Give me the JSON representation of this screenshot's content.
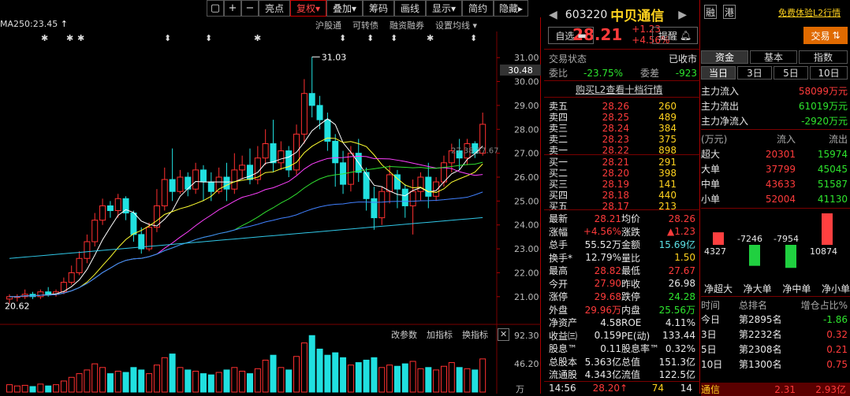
{
  "toolbar": {
    "items": [
      "亮点",
      "复权",
      "叠加",
      "筹码",
      "画线",
      "显示",
      "简约",
      "隐藏"
    ],
    "active": "复权",
    "icons": [
      "box-icon",
      "plus-icon",
      "minus-icon"
    ]
  },
  "chart": {
    "ma_label": "MA250:23.45",
    "sub_links": [
      "沪股通",
      "可转债",
      "融资融券",
      "设置均线"
    ],
    "y_ticks": [
      "31.00",
      "30.00",
      "29.00",
      "28.00",
      "27.00",
      "26.00",
      "25.00",
      "24.00",
      "23.00",
      "22.00",
      "21.00"
    ],
    "current_price_tag": "30.48",
    "high_label": "31.03",
    "low_label": "20.62",
    "mid_label": "27.38,27.67",
    "sub_links2": [
      "改参数",
      "加指标",
      "换指标"
    ],
    "vol_ticks": [
      "92.30",
      "46.20"
    ],
    "vol_unit": "万"
  },
  "chart_data": {
    "type": "candlestick",
    "y_range": [
      20.5,
      31.5
    ],
    "candles": [
      [
        20.9,
        21.0,
        20.7,
        21.1
      ],
      [
        21.0,
        21.0,
        20.8,
        21.1
      ],
      [
        21.0,
        21.1,
        20.9,
        21.3
      ],
      [
        21.1,
        21.0,
        20.9,
        21.2
      ],
      [
        21.0,
        21.2,
        20.9,
        21.3
      ],
      [
        21.2,
        21.1,
        21.0,
        21.4
      ],
      [
        21.1,
        21.2,
        21.0,
        21.3
      ],
      [
        21.2,
        21.6,
        21.1,
        21.8
      ],
      [
        21.6,
        22.0,
        21.5,
        22.3
      ],
      [
        22.0,
        22.6,
        21.9,
        22.9
      ],
      [
        22.6,
        23.3,
        22.4,
        23.6
      ],
      [
        23.3,
        24.2,
        23.1,
        24.5
      ],
      [
        24.2,
        24.8,
        24.0,
        25.1
      ],
      [
        24.8,
        24.6,
        24.3,
        25.0
      ],
      [
        24.6,
        25.1,
        24.3,
        25.3
      ],
      [
        25.1,
        24.5,
        24.2,
        25.2
      ],
      [
        24.5,
        23.6,
        23.3,
        24.6
      ],
      [
        23.6,
        23.0,
        22.8,
        23.9
      ],
      [
        23.0,
        23.9,
        22.9,
        24.1
      ],
      [
        23.9,
        24.8,
        23.7,
        25.5
      ],
      [
        24.8,
        25.9,
        24.6,
        26.4
      ],
      [
        25.9,
        25.4,
        25.0,
        27.2
      ],
      [
        25.4,
        26.0,
        25.3,
        26.3
      ],
      [
        26.0,
        25.5,
        25.2,
        26.2
      ],
      [
        25.5,
        26.3,
        25.3,
        26.6
      ],
      [
        26.3,
        25.8,
        25.0,
        26.5
      ],
      [
        25.8,
        25.4,
        25.0,
        26.2
      ],
      [
        25.4,
        26.0,
        25.3,
        26.4
      ],
      [
        26.0,
        25.5,
        25.0,
        26.6
      ],
      [
        25.5,
        26.3,
        25.3,
        27.0
      ],
      [
        26.3,
        26.5,
        25.9,
        26.9
      ],
      [
        26.5,
        25.9,
        25.7,
        27.2
      ],
      [
        25.9,
        26.8,
        25.7,
        27.3
      ],
      [
        26.8,
        27.4,
        26.5,
        28.0
      ],
      [
        27.4,
        26.6,
        26.2,
        28.4
      ],
      [
        26.6,
        27.1,
        26.3,
        27.5
      ],
      [
        27.1,
        26.3,
        26.0,
        27.3
      ],
      [
        26.3,
        27.8,
        26.1,
        28.2
      ],
      [
        27.8,
        29.5,
        27.4,
        30.1
      ],
      [
        29.5,
        29.0,
        28.5,
        31.03
      ],
      [
        29.0,
        28.4,
        28.0,
        29.4
      ],
      [
        28.4,
        27.5,
        27.1,
        28.7
      ],
      [
        27.5,
        26.6,
        25.6,
        27.8
      ],
      [
        26.6,
        25.7,
        25.3,
        27.1
      ],
      [
        25.7,
        27.0,
        25.4,
        27.3
      ],
      [
        27.0,
        26.2,
        25.8,
        27.6
      ],
      [
        26.2,
        25.1,
        24.6,
        26.4
      ],
      [
        25.1,
        24.3,
        23.8,
        25.6
      ],
      [
        24.3,
        25.4,
        24.0,
        25.6
      ],
      [
        25.4,
        26.1,
        24.9,
        26.5
      ],
      [
        26.1,
        25.5,
        24.7,
        26.3
      ],
      [
        25.5,
        24.8,
        24.3,
        25.7
      ],
      [
        24.8,
        25.4,
        23.6,
        25.9
      ],
      [
        25.4,
        26.0,
        25.0,
        26.2
      ],
      [
        26.0,
        25.2,
        24.7,
        26.6
      ],
      [
        25.2,
        25.8,
        25.0,
        26.0
      ],
      [
        25.8,
        26.6,
        25.6,
        26.9
      ],
      [
        26.6,
        27.1,
        26.2,
        27.4
      ],
      [
        27.1,
        26.8,
        26.3,
        27.6
      ],
      [
        26.8,
        27.4,
        26.5,
        27.6
      ],
      [
        27.4,
        27.0,
        26.8,
        27.5
      ],
      [
        27.0,
        28.21,
        26.9,
        28.7
      ]
    ],
    "volume": [
      12,
      10,
      11,
      9,
      13,
      10,
      12,
      18,
      24,
      30,
      36,
      46,
      40,
      30,
      34,
      32,
      40,
      36,
      30,
      44,
      56,
      62,
      40,
      36,
      34,
      30,
      28,
      32,
      36,
      40,
      34,
      30,
      38,
      52,
      60,
      40,
      36,
      58,
      80,
      92,
      70,
      60,
      64,
      56,
      44,
      48,
      52,
      56,
      40,
      44,
      42,
      46,
      50,
      38,
      40,
      36,
      42,
      48,
      40,
      38,
      36,
      54
    ]
  },
  "quote": {
    "code": "603220",
    "name": "中贝通信",
    "tags": [
      "融",
      "港"
    ],
    "free_l2": "免费体验L2行情",
    "price": "28.21",
    "change": "+1.23",
    "change_pct": "+4.56%",
    "watch_btn": "自选",
    "alert_btn": "提醒",
    "trade_btn": "交易",
    "status_label": "交易状态",
    "status_value": "已收市",
    "webi_label": "委比",
    "webi_value": "-23.75%",
    "weicha_label": "委差",
    "weicha_value": "-923",
    "l2_link": "购买L2查看十档行情",
    "asks": [
      {
        "label": "卖五",
        "price": "28.26",
        "vol": "260"
      },
      {
        "label": "卖四",
        "price": "28.25",
        "vol": "489"
      },
      {
        "label": "卖三",
        "price": "28.24",
        "vol": "384"
      },
      {
        "label": "卖二",
        "price": "28.23",
        "vol": "375"
      },
      {
        "label": "卖一",
        "price": "28.22",
        "vol": "898"
      }
    ],
    "bids": [
      {
        "label": "买一",
        "price": "28.21",
        "vol": "291"
      },
      {
        "label": "买二",
        "price": "28.20",
        "vol": "398"
      },
      {
        "label": "买三",
        "price": "28.19",
        "vol": "141"
      },
      {
        "label": "买四",
        "price": "28.18",
        "vol": "440"
      },
      {
        "label": "买五",
        "price": "28.17",
        "vol": "213"
      }
    ],
    "stats": [
      {
        "l1": "最新",
        "v1": "28.21",
        "c1": "red",
        "l2": "均价",
        "v2": "28.26",
        "c2": "red"
      },
      {
        "l1": "涨幅",
        "v1": "+4.56%",
        "c1": "red",
        "l2": "涨跌",
        "v2": "▲1.23",
        "c2": "red"
      },
      {
        "l1": "总手",
        "v1": "55.52万",
        "c1": "white",
        "l2": "金额",
        "v2": "15.69亿",
        "c2": "cyan"
      },
      {
        "l1": "换手*",
        "v1": "12.79%",
        "c1": "white",
        "l2": "量比",
        "v2": "1.50",
        "c2": "yellow"
      },
      {
        "l1": "最高",
        "v1": "28.82",
        "c1": "red",
        "l2": "最低",
        "v2": "27.67",
        "c2": "red"
      },
      {
        "l1": "今开",
        "v1": "27.90",
        "c1": "red",
        "l2": "昨收",
        "v2": "26.98",
        "c2": "white"
      },
      {
        "l1": "涨停",
        "v1": "29.68",
        "c1": "red",
        "l2": "跌停",
        "v2": "24.28",
        "c2": "green"
      },
      {
        "l1": "外盘",
        "v1": "29.96万",
        "c1": "red",
        "l2": "内盘",
        "v2": "25.56万",
        "c2": "green"
      },
      {
        "l1": "净资产",
        "v1": "4.58",
        "c1": "white",
        "l2": "ROE",
        "v2": "4.11%",
        "c2": "white"
      },
      {
        "l1": "收益㈢",
        "v1": "0.159",
        "c1": "white",
        "l2": "PE(动)",
        "v2": "133.44",
        "c2": "white"
      },
      {
        "l1": "股息™",
        "v1": "0.11",
        "c1": "white",
        "l2": "股息率™",
        "v2": "0.32%",
        "c2": "white"
      },
      {
        "l1": "总股本",
        "v1": "5.363亿",
        "c1": "white",
        "l2": "总值",
        "v2": "151.3亿",
        "c2": "white"
      },
      {
        "l1": "流通股",
        "v1": "4.343亿",
        "c1": "white",
        "l2": "流值",
        "v2": "122.5亿",
        "c2": "white"
      }
    ],
    "last_tick": {
      "time": "14:56",
      "price": "28.20",
      "arrow": "↑",
      "vol": "74",
      "num": "14"
    }
  },
  "fund": {
    "tabs": [
      "资金",
      "基本",
      "指数"
    ],
    "period_tabs": [
      "当日",
      "3日",
      "5日",
      "10日"
    ],
    "flows": [
      {
        "label": "主力流入",
        "value": "58099万元",
        "color": "red"
      },
      {
        "label": "主力流出",
        "value": "61019万元",
        "color": "green"
      },
      {
        "label": "主力净流入",
        "value": "-2920万元",
        "color": "green"
      }
    ],
    "table_header": [
      "(万元)",
      "流入",
      "流出"
    ],
    "table": [
      {
        "label": "超大",
        "in": "20301",
        "out": "15974"
      },
      {
        "label": "大单",
        "in": "37799",
        "out": "45045"
      },
      {
        "label": "中单",
        "in": "43633",
        "out": "51587"
      },
      {
        "label": "小单",
        "in": "52004",
        "out": "41130"
      }
    ],
    "net_bars": [
      {
        "value": 4327,
        "label": "4327"
      },
      {
        "value": -7246,
        "label": "-7246"
      },
      {
        "value": -7954,
        "label": "-7954"
      },
      {
        "value": 10874,
        "label": "10874"
      }
    ],
    "net_labels": [
      "净超大",
      "净大单",
      "净中单",
      "净小单"
    ],
    "rank_header": [
      "时间",
      "总排名",
      "增仓占比%"
    ],
    "ranks": [
      {
        "time": "今日",
        "rank": "第2895名",
        "pct": "-1.86",
        "color": "green"
      },
      {
        "time": "3日",
        "rank": "第2232名",
        "pct": "0.32",
        "color": "red"
      },
      {
        "time": "5日",
        "rank": "第2308名",
        "pct": "0.21",
        "color": "red"
      },
      {
        "time": "10日",
        "rank": "第1300名",
        "pct": "0.75",
        "color": "red"
      }
    ],
    "bottom_header": [
      "通信",
      "2.31",
      "2.93亿"
    ]
  }
}
